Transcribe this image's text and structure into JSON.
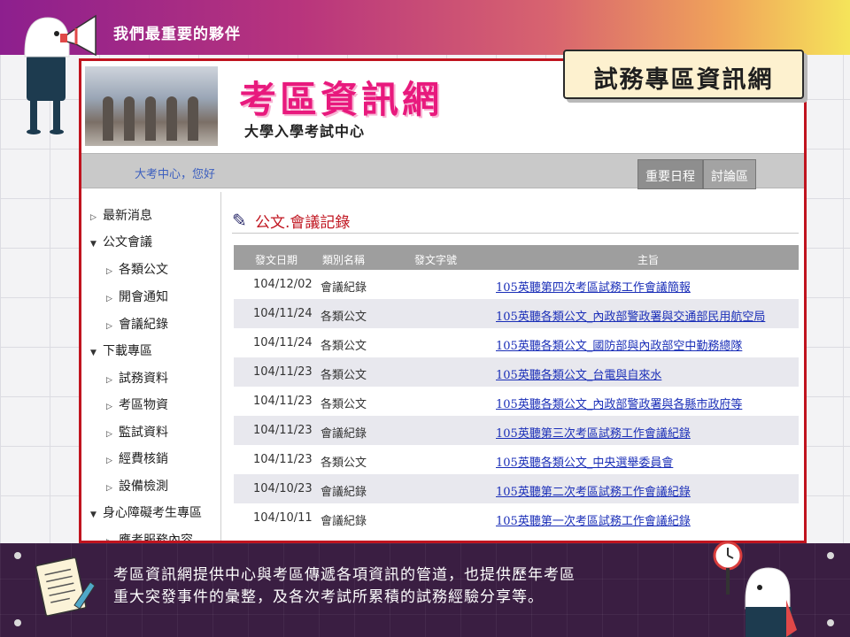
{
  "header": {
    "title": "我們最重要的夥伴"
  },
  "callout": {
    "label": "試務專區資訊網"
  },
  "site": {
    "logo": "考區資訊網",
    "subtitle": "大學入學考試中心",
    "greeting": "大考中心，您好",
    "tabs": [
      "重要日程",
      "討論區"
    ]
  },
  "sidebar": {
    "items": [
      {
        "label": "最新消息",
        "level": 0,
        "expanded": false
      },
      {
        "label": "公文會議",
        "level": 0,
        "expanded": true
      },
      {
        "label": "各類公文",
        "level": 1,
        "expanded": false
      },
      {
        "label": "開會通知",
        "level": 1,
        "expanded": false
      },
      {
        "label": "會議紀錄",
        "level": 1,
        "expanded": false
      },
      {
        "label": "下載專區",
        "level": 0,
        "expanded": true
      },
      {
        "label": "試務資料",
        "level": 1,
        "expanded": false
      },
      {
        "label": "考區物資",
        "level": 1,
        "expanded": false
      },
      {
        "label": "監試資料",
        "level": 1,
        "expanded": false
      },
      {
        "label": "經費核銷",
        "level": 1,
        "expanded": false
      },
      {
        "label": "設備檢測",
        "level": 1,
        "expanded": false
      },
      {
        "label": "身心障礙考生專區",
        "level": 0,
        "expanded": true
      },
      {
        "label": "應考服務內容",
        "level": 1,
        "expanded": false
      }
    ]
  },
  "main": {
    "section_title": "公文.會議記錄",
    "columns": [
      "發文日期",
      "類別名稱",
      "發文字號",
      "主旨"
    ],
    "rows": [
      {
        "date": "104/12/02",
        "type": "會議紀錄",
        "number": "",
        "subject": "105英聽第四次考區試務工作會議簡報"
      },
      {
        "date": "104/11/24",
        "type": "各類公文",
        "number": "",
        "subject": "105英聽各類公文_內政部警政署與交通部民用航空局"
      },
      {
        "date": "104/11/24",
        "type": "各類公文",
        "number": "",
        "subject": "105英聽各類公文_國防部與內政部空中勤務總隊"
      },
      {
        "date": "104/11/23",
        "type": "各類公文",
        "number": "",
        "subject": "105英聽各類公文_台電與自來水"
      },
      {
        "date": "104/11/23",
        "type": "各類公文",
        "number": "",
        "subject": "105英聽各類公文_內政部警政署與各縣市政府等"
      },
      {
        "date": "104/11/23",
        "type": "會議紀錄",
        "number": "",
        "subject": "105英聽第三次考區試務工作會議紀錄"
      },
      {
        "date": "104/11/23",
        "type": "各類公文",
        "number": "",
        "subject": "105英聽各類公文_中央選舉委員會"
      },
      {
        "date": "104/10/23",
        "type": "會議紀錄",
        "number": "",
        "subject": "105英聽第二次考區試務工作會議紀錄"
      },
      {
        "date": "104/10/11",
        "type": "會議紀錄",
        "number": "",
        "subject": "105英聽第一次考區試務工作會議紀錄"
      }
    ]
  },
  "footer": {
    "line1": "考區資訊網提供中心與考區傳遞各項資訊的管道，也提供歷年考區",
    "line2": "重大突發事件的彙整，及各次考試所累積的試務經驗分享等。"
  },
  "colors": {
    "accent": "#c0141f",
    "link": "#1b2fb8",
    "logo": "#e8197d",
    "banner_dark": "#3a1e42"
  }
}
